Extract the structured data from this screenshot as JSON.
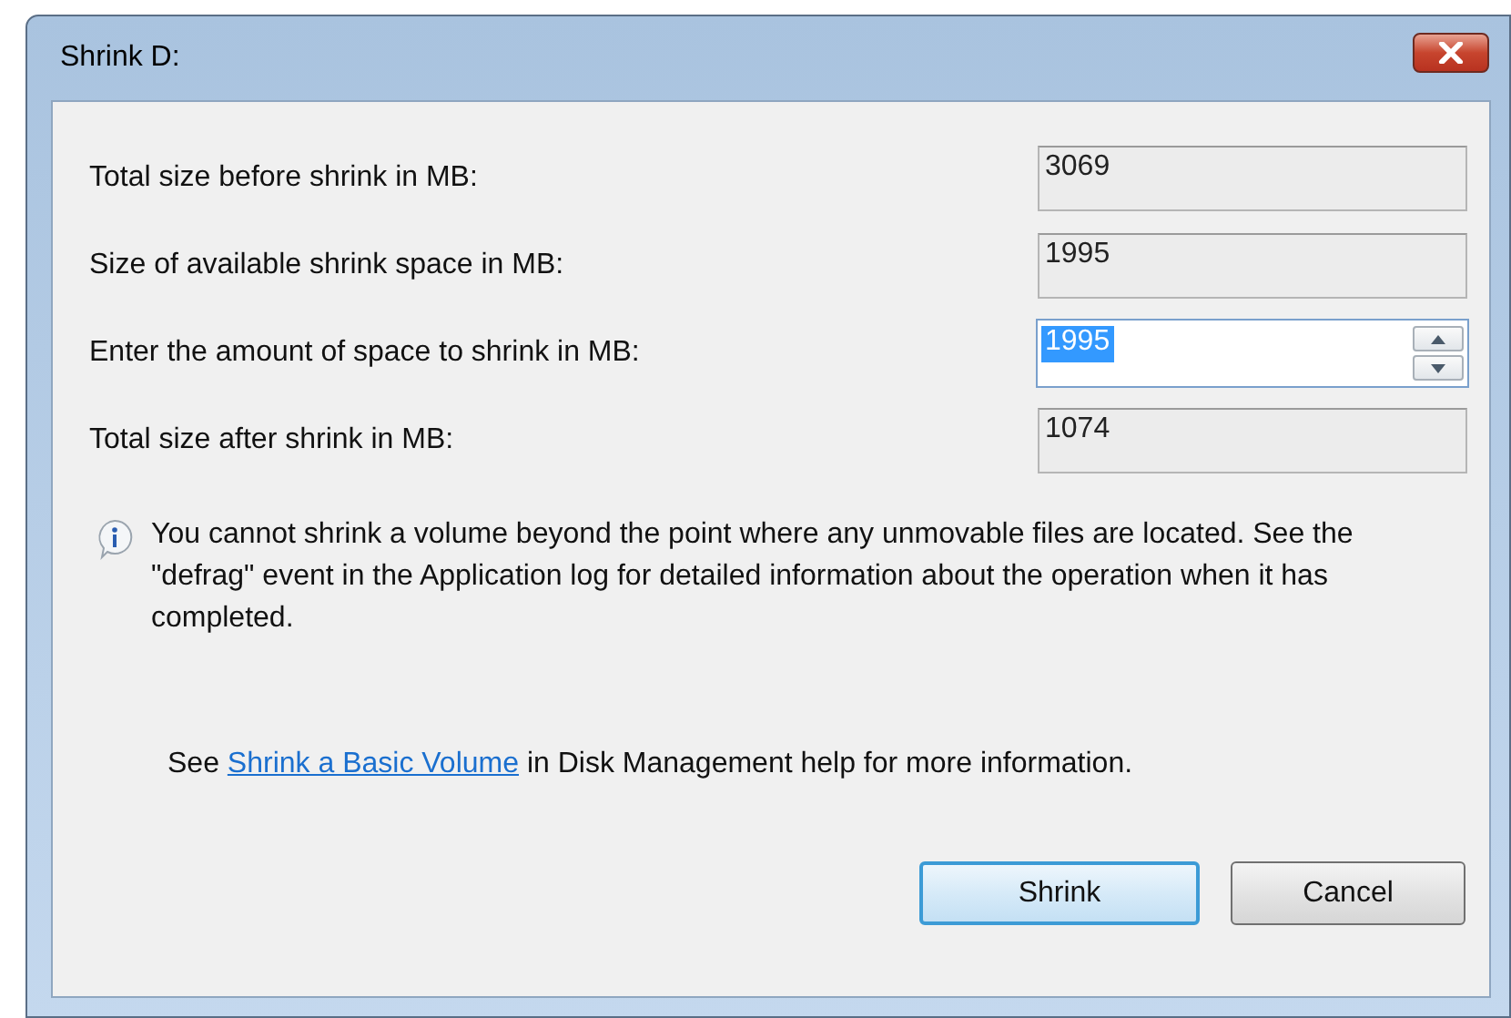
{
  "window": {
    "title": "Shrink D:"
  },
  "fields": [
    {
      "label": "Total size before shrink in MB:",
      "value": "3069",
      "kind": "readonly"
    },
    {
      "label": "Size of available shrink space in MB:",
      "value": "1995",
      "kind": "readonly"
    },
    {
      "label": "Enter the amount of space to shrink in MB:",
      "value": "1995",
      "kind": "spin",
      "selected": true
    },
    {
      "label": "Total size after shrink in MB:",
      "value": "1074",
      "kind": "readonly"
    }
  ],
  "info": "You cannot shrink a volume beyond the point where any unmovable files are located. See the \"defrag\" event in the Application log for detailed information about the operation when it has completed.",
  "help": {
    "before": "See",
    "link": "Shrink a Basic Volume",
    "after": "in Disk Management help for more information."
  },
  "buttons": [
    {
      "label": "Shrink",
      "default": true
    },
    {
      "label": "Cancel",
      "default": false
    }
  ]
}
